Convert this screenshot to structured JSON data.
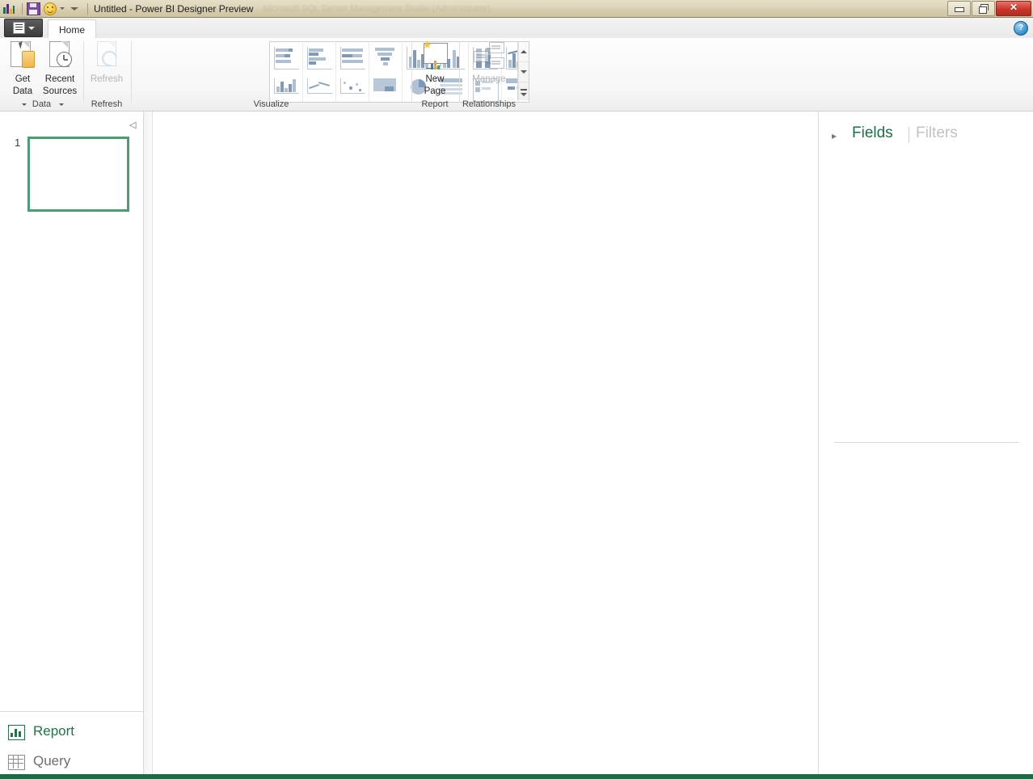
{
  "window": {
    "title": "Untitled - Power BI Designer Preview",
    "ghost_title": "Microsoft SQL Server Management Studio (Administrator)",
    "app_icon": "powerbi-logo-icon",
    "save_icon": "save-floppy-icon",
    "smiley_icon": "smiley-face-icon",
    "quick_access_caret": "chevron-down-icon",
    "controls": {
      "minimize": "minimize-icon",
      "restore": "restore-icon",
      "close": "✕"
    }
  },
  "ribbon": {
    "file_menu_label": "file-menu",
    "tabs": [
      {
        "label": "Home",
        "active": true
      }
    ],
    "help_label": "?",
    "groups": [
      {
        "name": "Data",
        "label": "Data"
      },
      {
        "name": "Refresh",
        "label": "Refresh"
      },
      {
        "name": "Visualize",
        "label": "Visualize"
      },
      {
        "name": "Report",
        "label": "Report"
      },
      {
        "name": "Relationships",
        "label": "Relationships"
      }
    ],
    "buttons": {
      "get_data": {
        "line1": "Get",
        "line2": "Data",
        "has_caret": true,
        "disabled": false,
        "icon": "get-data-icon"
      },
      "recent_sources": {
        "line1": "Recent",
        "line2": "Sources",
        "has_caret": true,
        "disabled": false,
        "icon": "recent-sources-icon"
      },
      "refresh": {
        "line1": "Refresh",
        "line2": "",
        "has_caret": false,
        "disabled": true,
        "icon": "refresh-icon"
      },
      "new_page": {
        "line1": "New",
        "line2": "Page",
        "has_caret": false,
        "disabled": false,
        "icon": "new-page-icon"
      },
      "manage": {
        "line1": "Manage",
        "line2": "",
        "has_caret": false,
        "disabled": true,
        "icon": "manage-relationships-icon"
      }
    },
    "gallery": {
      "row1": [
        "stacked-bar-chart-icon",
        "clustered-bar-chart-icon",
        "hundred-percent-stacked-bar-chart-icon",
        "funnel-chart-icon",
        "stacked-column-chart-icon",
        "clustered-column-chart-icon",
        "hundred-percent-stacked-column-chart-icon",
        "combo-chart-icon"
      ],
      "row2": [
        "waterfall-chart-icon",
        "line-chart-icon",
        "scatter-chart-icon",
        "map-visual-icon",
        "pie-chart-icon",
        "table-visual-icon",
        "matrix-visual-icon",
        "card-visual-icon"
      ],
      "scroll_up": "scroll-up-icon",
      "scroll_down": "scroll-down-icon",
      "expand_gallery": "expand-gallery-icon"
    }
  },
  "pages_pane": {
    "collapse_icon": "collapse-left-icon",
    "pages": [
      {
        "number": "1",
        "selected": true
      }
    ]
  },
  "nav": {
    "items": [
      {
        "label": "Report",
        "icon": "report-view-icon",
        "active": true
      },
      {
        "label": "Query",
        "icon": "query-view-icon",
        "active": false
      }
    ]
  },
  "right_pane": {
    "expand_icon": "chevron-right-icon",
    "tabs": [
      {
        "label": "Fields",
        "active": true
      },
      {
        "label": "Filters",
        "active": false
      }
    ]
  },
  "colors": {
    "accent_green": "#217346",
    "page_border_green": "#4a9e72",
    "status_bar_green": "#1d6b44",
    "titlebar_tan": "#ddd5ba",
    "close_red": "#c9372c",
    "viz_icon_blue": "#aebfd2",
    "disabled_gray": "#b4b4b4"
  }
}
